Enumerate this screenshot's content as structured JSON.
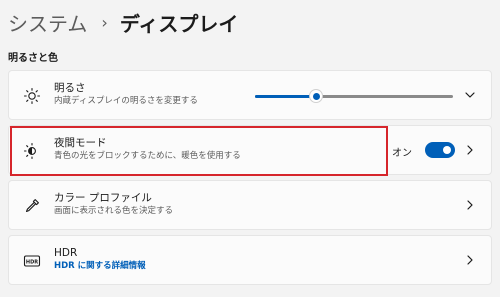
{
  "breadcrumb": {
    "parent": "システム",
    "separator": "›",
    "current": "ディスプレイ"
  },
  "section": {
    "title": "明るさと色"
  },
  "brightness": {
    "title": "明るさ",
    "subtitle": "内蔵ディスプレイの明るさを変更する",
    "value": 0.31,
    "icon": "sun-icon"
  },
  "night_light": {
    "title": "夜間モード",
    "subtitle": "青色の光をブロックするために、暖色を使用する",
    "toggle_label": "オン",
    "toggle_on": true,
    "icon": "night-light-icon"
  },
  "color_profile": {
    "title": "カラー プロファイル",
    "subtitle": "画面に表示される色を決定する",
    "icon": "eyedropper-icon"
  },
  "hdr": {
    "title": "HDR",
    "link": "HDR に関する詳細情報",
    "icon": "hdr-icon"
  },
  "colors": {
    "accent": "#005fb8",
    "highlight": "#d6252b"
  }
}
